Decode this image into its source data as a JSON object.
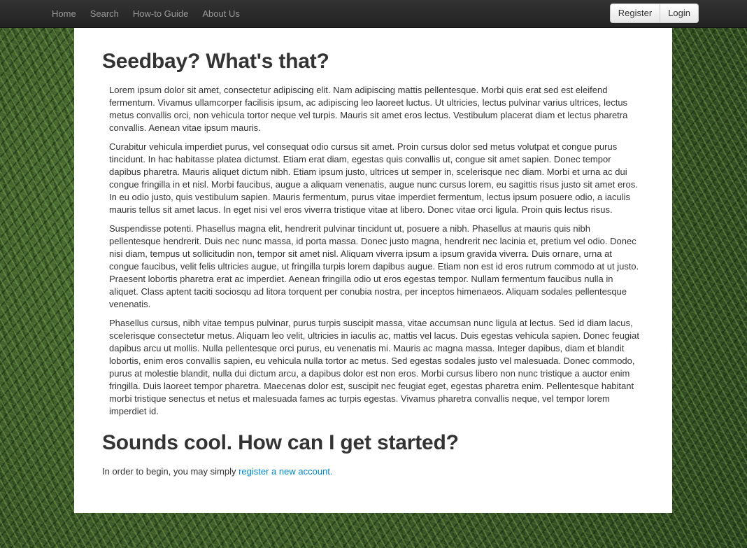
{
  "nav": {
    "links": [
      {
        "label": "Home"
      },
      {
        "label": "Search"
      },
      {
        "label": "How-to Guide"
      },
      {
        "label": "About Us"
      }
    ],
    "register_label": "Register",
    "login_label": "Login"
  },
  "main": {
    "heading1": "Seedbay? What's that?",
    "paragraphs": [
      "Lorem ipsum dolor sit amet, consectetur adipiscing elit. Nam adipiscing mattis pellentesque. Morbi quis erat sed est eleifend fermentum. Vivamus ullamcorper facilisis ipsum, ac adipiscing leo laoreet luctus. Ut ultricies, lectus pulvinar varius ultrices, lectus metus convallis orci, non vehicula tortor neque vel turpis. Mauris sit amet eros lectus. Vestibulum placerat diam et lectus pharetra convallis. Aenean vitae ipsum mauris.",
      "Curabitur vehicula imperdiet purus, vel consequat odio cursus sit amet. Proin cursus dolor sed metus volutpat et congue purus tincidunt. In hac habitasse platea dictumst. Etiam erat diam, egestas quis convallis ut, congue sit amet sapien. Donec tempor dapibus pharetra. Mauris aliquet dictum nibh. Etiam ipsum justo, ultrices ut semper in, scelerisque nec diam. Morbi et urna ac dui congue fringilla in et nisl. Morbi faucibus, augue a aliquam venenatis, augue nunc cursus lorem, eu sagittis risus justo sit amet eros. In eu odio justo, quis vestibulum sapien. Mauris fermentum, purus vitae imperdiet fermentum, lectus ipsum posuere odio, a iaculis mauris tellus sit amet lacus. In eget nisi vel eros viverra tristique vitae at libero. Donec vitae orci ligula. Proin quis lectus risus.",
      "Suspendisse potenti. Phasellus magna elit, hendrerit pulvinar tincidunt ut, posuere a nibh. Phasellus at mauris quis nibh pellentesque hendrerit. Duis nec nunc massa, id porta massa. Donec justo magna, hendrerit nec lacinia et, pretium vel odio. Donec nisi diam, tempus ut sollicitudin non, tempor sit amet nisl. Aliquam viverra ipsum a ipsum gravida viverra. Duis ornare, urna at congue faucibus, velit felis ultricies augue, ut fringilla turpis lorem dapibus augue. Etiam non est id eros rutrum commodo at ut justo. Praesent lobortis pharetra erat ac imperdiet. Aenean fringilla odio ut eros egestas tempor. Nullam fermentum faucibus nulla in aliquet. Class aptent taciti sociosqu ad litora torquent per conubia nostra, per inceptos himenaeos. Aliquam sodales pellentesque venenatis.",
      "Phasellus cursus, nibh vitae tempus pulvinar, purus turpis suscipit massa, vitae accumsan nunc ligula at lectus. Sed id diam lacus, scelerisque consectetur metus. Aliquam leo velit, ultricies in iaculis ac, mattis vel lacus. Duis egestas vehicula sapien. Donec feugiat dapibus arcu ut mollis. Nulla pellentesque orci purus, eu venenatis mi. Mauris ac magna massa. Integer dapibus, diam et blandit lobortis, enim eros convallis sapien, eu vehicula nulla tortor ac metus. Sed egestas sodales justo vel malesuada. Donec commodo, purus at molestie blandit, nulla dui dictum arcu, a dapibus dolor est non eros. Morbi cursus libero non nunc tristique a auctor enim fringilla. Duis laoreet tempor pharetra. Maecenas dolor est, suscipit nec feugiat eget, egestas pharetra enim. Pellentesque habitant morbi tristique senectus et netus et malesuada fames ac turpis egestas. Vivamus pharetra convallis neque, vel tempor lorem imperdiet id."
    ],
    "heading2": "Sounds cool. How can I get started?",
    "start_text": "In order to begin, you may simply ",
    "start_link": "register a new account."
  },
  "colors": {
    "navbar": "#222222",
    "link": "#0088cc",
    "background": "#3d5a2a"
  }
}
